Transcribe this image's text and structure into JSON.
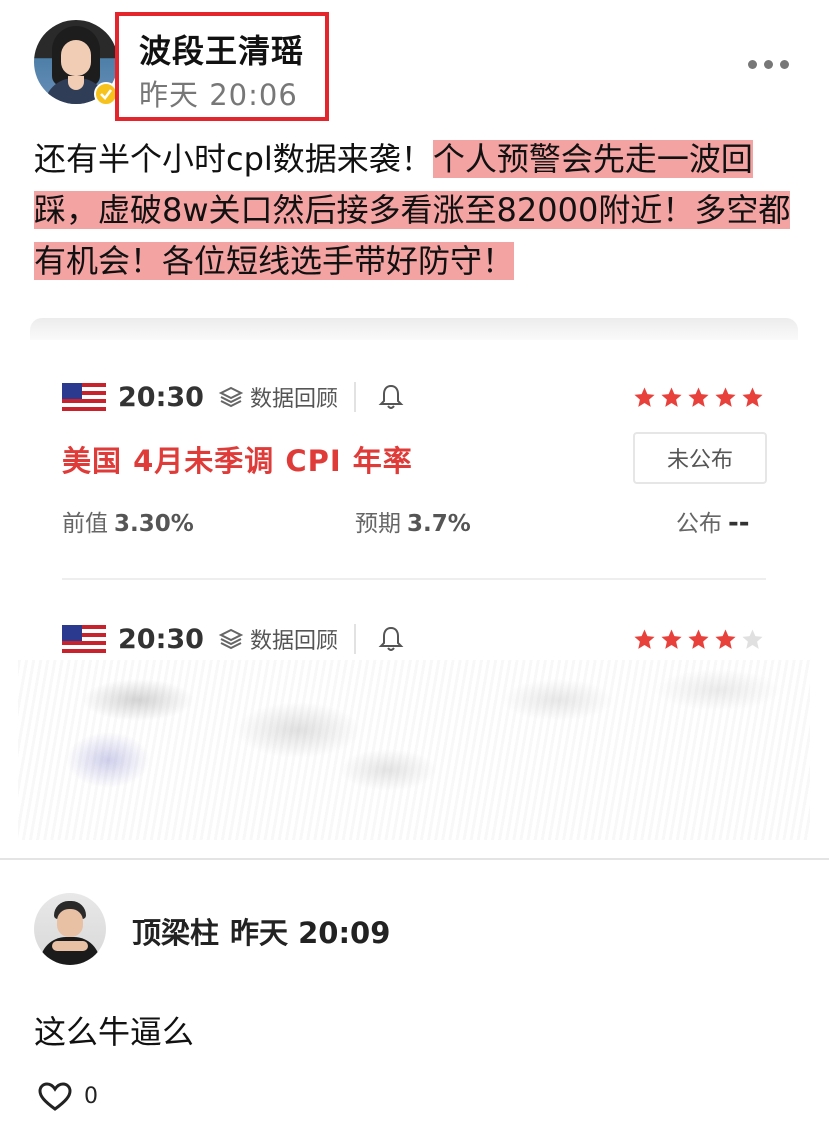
{
  "post": {
    "author": "波段王清瑶",
    "time": "昨天 20:06",
    "text_plain": "还有半个小时cpl数据来袭！",
    "text_highlight": "个人预警会先走一波回踩，虚破8w关口然后接多看涨至82000附近！多空都有机会！各位短线选手带好防守！"
  },
  "events": [
    {
      "time": "20:30",
      "link_label": "数据回顾",
      "stars_filled": 5,
      "stars_total": 5,
      "title": "美国 4月未季调 CPI 年率",
      "status": "未公布",
      "previous_label": "前值",
      "previous_value": "3.30%",
      "forecast_label": "预期",
      "forecast_value": "3.7%",
      "actual_label": "公布",
      "actual_value": "--"
    },
    {
      "time": "20:30",
      "link_label": "数据回顾",
      "stars_filled": 4,
      "stars_total": 5
    }
  ],
  "comment": {
    "author": "顶梁柱",
    "time": "昨天 20:09",
    "text": "这么牛逼么",
    "likes": "0"
  },
  "colors": {
    "highlight": "#f4a3a3",
    "frame_red": "#e4262c",
    "event_title_red": "#df3b38",
    "star_on": "#e8403a",
    "star_off": "#e0e0e0",
    "verified": "#f6c21c"
  },
  "icons": [
    "more-icon",
    "verified-icon",
    "us-flag-icon",
    "layers-icon",
    "bell-icon",
    "star-icon",
    "heart-icon"
  ]
}
